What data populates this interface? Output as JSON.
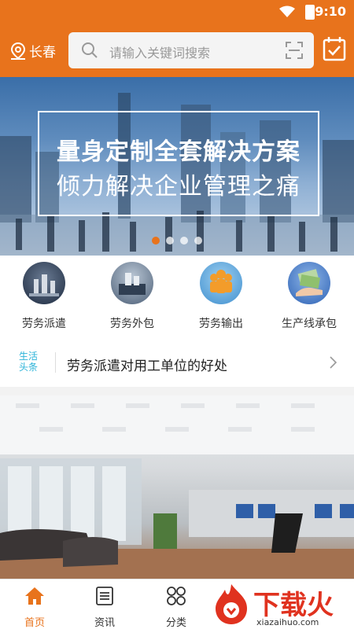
{
  "status_bar": {
    "time": "9:10"
  },
  "header": {
    "city": "长春",
    "search_placeholder": "请输入关键词搜索"
  },
  "banner": {
    "line1": "量身定制全套解决方案",
    "line2": "倾力解决企业管理之痛",
    "slide_count": 4,
    "active_slide": 1
  },
  "categories": [
    {
      "label": "劳务派遣",
      "icon": "chess-pieces-icon"
    },
    {
      "label": "劳务外包",
      "icon": "chess-board-icon"
    },
    {
      "label": "劳务输出",
      "icon": "team-figures-icon"
    },
    {
      "label": "生产线承包",
      "icon": "money-hand-icon"
    }
  ],
  "news": {
    "tag": "生活头条",
    "headline": "劳务派遣对用工单位的好处"
  },
  "tabbar": [
    {
      "label": "首页",
      "icon": "home-icon",
      "active": true
    },
    {
      "label": "资讯",
      "icon": "document-icon",
      "active": false
    },
    {
      "label": "分类",
      "icon": "grid-icon",
      "active": false
    }
  ],
  "watermark": {
    "text": "下载火",
    "url": "xiazaihuo.com"
  },
  "colors": {
    "brand": "#e8731c",
    "tag": "#2bb3d8",
    "watermark": "#e0321f"
  }
}
